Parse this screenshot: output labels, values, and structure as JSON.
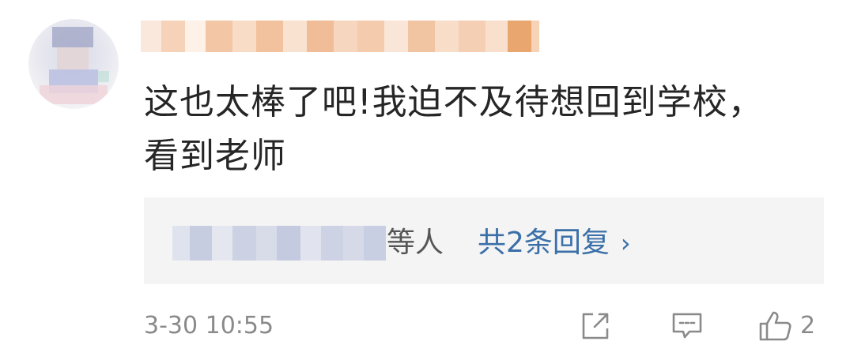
{
  "comment": {
    "text": "这也太棒了吧!我迫不及待想回到学校，看到老师",
    "timestamp": "3-30 10:55",
    "like_count": "2"
  },
  "replies": {
    "suffix": "等人",
    "count_label": "共2条回复",
    "chevron": "›"
  },
  "icons": {
    "share": "share-icon",
    "reply": "comment-icon",
    "like": "thumbs-up-icon"
  },
  "colors": {
    "text": "#262626",
    "link": "#3a6fa8",
    "muted": "#8a8a8a",
    "reply_bg": "#f4f4f4"
  }
}
